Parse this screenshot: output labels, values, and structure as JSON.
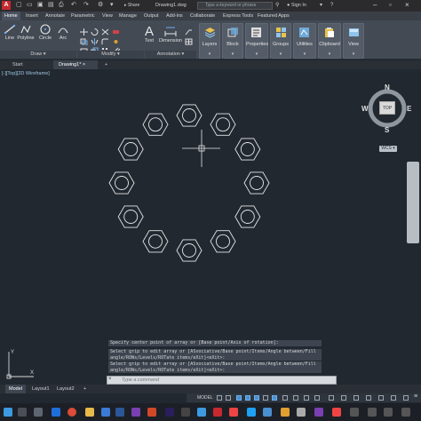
{
  "titlebar": {
    "logo": "A",
    "share": "Share",
    "document": "Drawing1.dwg",
    "search_placeholder": "Type a keyword or phrase",
    "signin": "Sign In"
  },
  "ribbon_tabs": [
    "Home",
    "Insert",
    "Annotate",
    "Parametric",
    "View",
    "Manage",
    "Output",
    "Add-ins",
    "Collaborate",
    "Express Tools",
    "Featured Apps"
  ],
  "ribbon": {
    "draw_buttons": [
      "Line",
      "Polyline",
      "Circle",
      "Arc"
    ],
    "annotation_buttons": [
      "Text",
      "Dimension"
    ],
    "panels": [
      "Draw",
      "Modify",
      "Annotation"
    ],
    "big_buttons": [
      "Layers",
      "Block",
      "Properties",
      "Groups",
      "Utilities",
      "Clipboard",
      "View"
    ]
  },
  "file_tabs": [
    "Start",
    "Drawing1*"
  ],
  "viewport": {
    "label": "[-][Top][2D Wireframe]",
    "hexagon_count": 12
  },
  "viewcube": {
    "n": "N",
    "s": "S",
    "e": "E",
    "w": "W",
    "top": "TOP",
    "wcs": "WCS"
  },
  "command_history": [
    "Specify center point of array or [Base point/Axis of rotation]:",
    "Select grip to edit array or [ASsociative/Base point/Items/Angle between/Fill angle/ROWs/Levels/ROTate items/eXit]<eXit>:",
    "Select grip to edit array or [ASsociative/Base point/Items/Angle between/Fill angle/ROWs/Levels/ROTate items/eXit]<eXit>:"
  ],
  "command_placeholder": "Type a command",
  "layout_tabs": [
    "Model",
    "Layout1",
    "Layout2"
  ],
  "status": {
    "model_label": "MODEL"
  },
  "colors": {
    "accent": "#4a8fd0",
    "canvas": "#212830",
    "logo": "#c8282f"
  }
}
